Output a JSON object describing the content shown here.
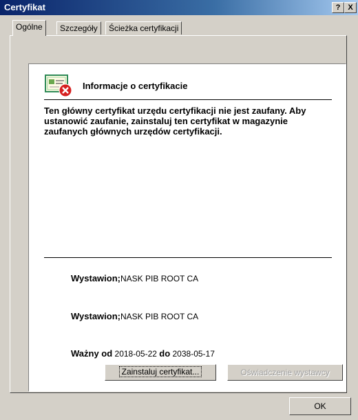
{
  "window": {
    "title": "Certyfikat",
    "help_button": "?",
    "close_button": "X"
  },
  "tabs": [
    {
      "label": "Ogólne",
      "active": true
    },
    {
      "label": "Szczegóły",
      "active": false
    },
    {
      "label": "Ścieżka certyfikacji",
      "active": false
    }
  ],
  "info": {
    "heading": "Informacje o certyfikacie",
    "warning": "Ten główny certyfikat urzędu certyfikacji nie jest zaufany. Aby ustanowić zaufanie, zainstaluj ten certyfikat w magazynie zaufanych głównych urzędów certyfikacji.",
    "issued_to_label": "Wystawion;",
    "issued_to_value": "NASK PIB ROOT CA",
    "issued_by_label": "Wystawion;",
    "issued_by_value": "NASK PIB ROOT CA",
    "valid_from_label": "Ważny od",
    "valid_from_value": "2018-05-22",
    "valid_to_label": "do",
    "valid_to_value": "2038-05-17"
  },
  "buttons": {
    "install": "Zainstaluj certyfikat...",
    "issuer_statement": "Oświadczenie wystawcy",
    "ok": "OK"
  },
  "icons": {
    "certificate": "certificate-error-icon"
  }
}
